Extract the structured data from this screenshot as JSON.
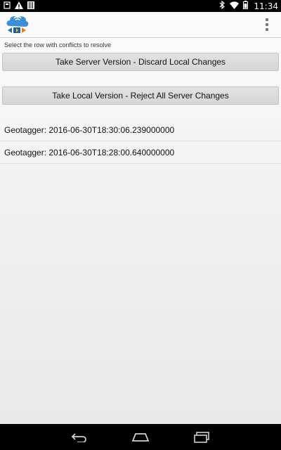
{
  "status_bar": {
    "time": "11:34",
    "left_icons": [
      "notification-square-icon",
      "warning-icon",
      "barcode-icon"
    ],
    "right_icons": [
      "bluetooth-icon",
      "wifi-icon",
      "battery-icon"
    ]
  },
  "action_bar": {
    "logo_icon": "app-logo-icon",
    "overflow_icon": "overflow-menu-icon"
  },
  "content": {
    "instruction": "Select the row with conflicts to resolve",
    "take_server_label": "Take Server Version - Discard Local Changes",
    "take_local_label": "Take Local Version - Reject All Server Changes",
    "conflict_rows": [
      "Geotagger: 2016-06-30T18:30:06.239000000",
      "Geotagger: 2016-06-30T18:28:00.640000000"
    ]
  },
  "nav_bar": {
    "icons": [
      "back-icon",
      "home-icon",
      "recent-apps-icon"
    ]
  },
  "colors": {
    "status_bar": "#000000",
    "action_bar": "#fafafa",
    "button_bg": "#d9d9d9",
    "nav_bar": "#000000"
  }
}
